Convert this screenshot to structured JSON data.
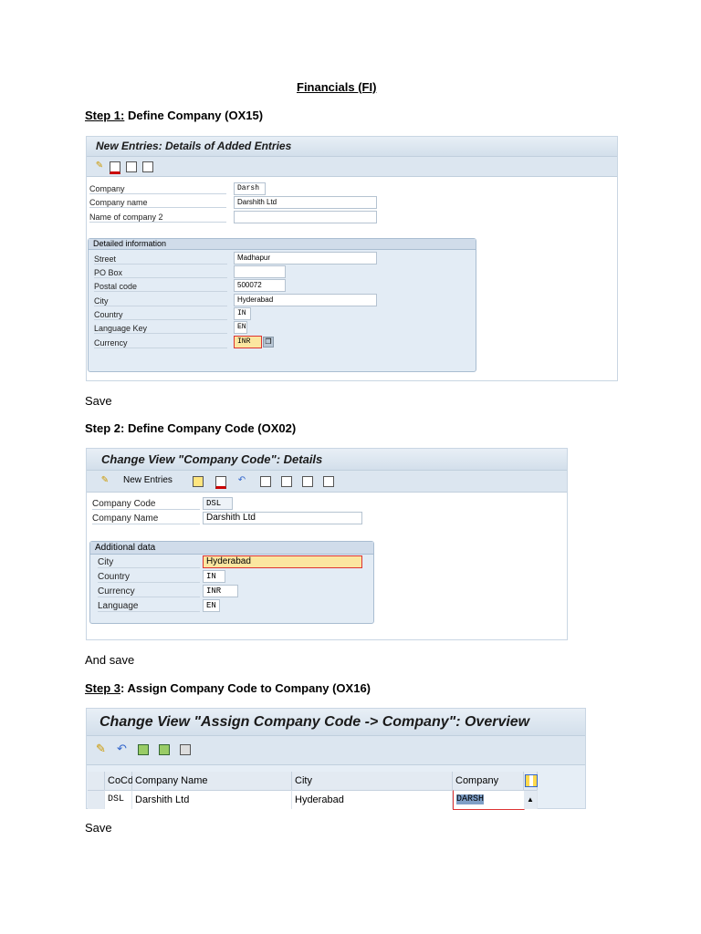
{
  "doc": {
    "title": "Financials (FI)",
    "step1_prefix": "Step 1:",
    "step1_text": " Define Company (OX15)",
    "save1": "Save",
    "step2": "Step 2: Define Company Code (OX02)",
    "save2": "And save",
    "step3_prefix": "Step 3",
    "step3_text": ": Assign Company Code to Company (OX16)",
    "save3": "Save"
  },
  "s1": {
    "title": "New Entries: Details of Added Entries",
    "fields": [
      {
        "label": "Company",
        "value": "Darsh"
      },
      {
        "label": "Company name",
        "value": "Darshith Ltd"
      },
      {
        "label": "Name of company 2",
        "value": ""
      }
    ],
    "group": "Detailed information",
    "gfields": [
      {
        "label": "Street",
        "value": "Madhapur"
      },
      {
        "label": "PO Box",
        "value": ""
      },
      {
        "label": "Postal code",
        "value": "500072"
      },
      {
        "label": "City",
        "value": "Hyderabad"
      },
      {
        "label": "Country",
        "value": "IN"
      },
      {
        "label": "Language Key",
        "value": "EN"
      },
      {
        "label": "Currency",
        "value": "INR"
      }
    ]
  },
  "s2": {
    "title": "Change View \"Company Code\": Details",
    "new_entries": "New Entries",
    "fields": [
      {
        "label": "Company Code",
        "value": "DSL"
      },
      {
        "label": "Company Name",
        "value": "Darshith Ltd"
      }
    ],
    "group": "Additional data",
    "gfields": [
      {
        "label": "City",
        "value": "Hyderabad"
      },
      {
        "label": "Country",
        "value": "IN"
      },
      {
        "label": "Currency",
        "value": "INR"
      },
      {
        "label": "Language",
        "value": "EN"
      }
    ]
  },
  "s3": {
    "title": "Change View \"Assign Company Code -> Company\": Overview",
    "columns": [
      "CoCd",
      "Company Name",
      "City",
      "Company"
    ],
    "row": [
      "DSL",
      "Darshith Ltd",
      "Hyderabad",
      "DARSH"
    ]
  }
}
